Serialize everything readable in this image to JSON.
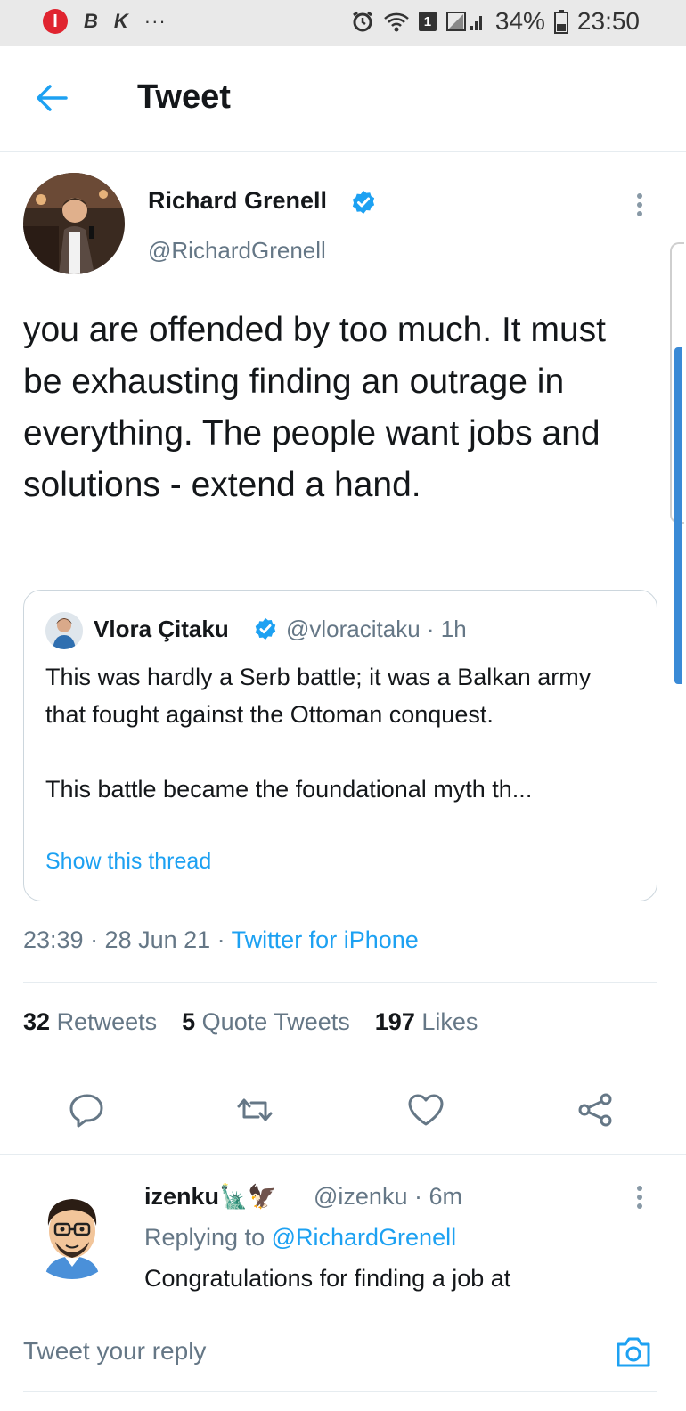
{
  "status_bar": {
    "app_badge": "I",
    "icon_b": "B",
    "icon_k": "K",
    "overflow": "···",
    "sim_slot": "1",
    "battery": "34%",
    "time": "23:50"
  },
  "header": {
    "title": "Tweet"
  },
  "tweet": {
    "author_name": "Richard Grenell",
    "author_handle": "@RichardGrenell",
    "text": "you are offended by too much. It must be exhausting finding an outrage in everything. The people want jobs and solutions - extend a hand.",
    "quoted": {
      "name": "Vlora Çitaku",
      "handle": "@vloracitaku · 1h",
      "text": "This was hardly a Serb battle; it was a Balkan army that fought against the Ottoman conquest.\n\nThis battle became the foundational myth th...",
      "show_thread": "Show this thread"
    },
    "time": "23:39 · 28 Jun 21 · ",
    "source": "Twitter for iPhone",
    "stats": {
      "retweets_count": "32",
      "retweets_label": "Retweets",
      "quotes_count": "5",
      "quotes_label": "Quote Tweets",
      "likes_count": "197",
      "likes_label": "Likes"
    }
  },
  "reply": {
    "name": "izenku",
    "emoji": "🗽🦅",
    "handle": "@izenku · 6m",
    "replying_label": "Replying to ",
    "replying_mention": "@RichardGrenell",
    "text": "Congratulations for finding a job at"
  },
  "compose": {
    "placeholder": "Tweet your reply"
  },
  "colors": {
    "accent": "#1da1f2",
    "muted": "#657786",
    "text": "#14171a",
    "divider": "#e6ecf0"
  }
}
